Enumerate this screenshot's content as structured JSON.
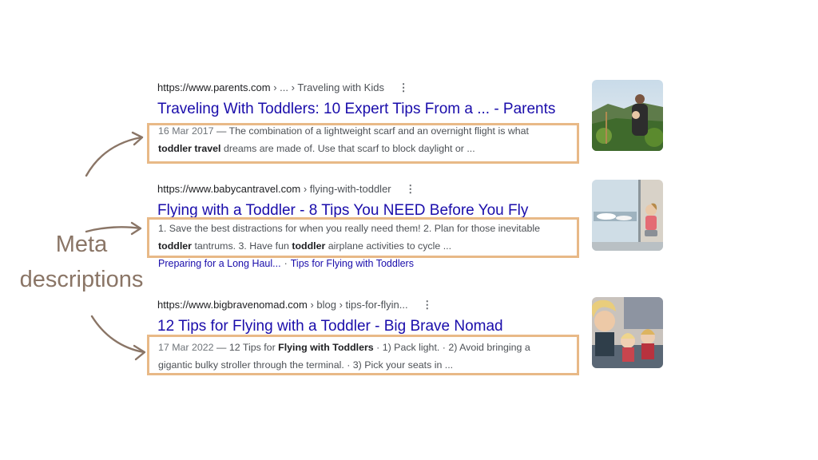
{
  "results": [
    {
      "url_host": "https://www.parents.com",
      "url_path": " › ... › Traveling with Kids",
      "title": "Traveling With Toddlers: 10 Expert Tips From a ... - Parents",
      "date": "16 Mar 2017",
      "snippet_line1": " — The combination of a lightweight scarf and an overnight flight is what",
      "snippet_bold": "toddler travel",
      "snippet_line2": " dreams are made of. Use that scarf to block daylight or ...",
      "thumbnail": "mountain-hiker-with-child"
    },
    {
      "url_host": "https://www.babycantravel.com",
      "url_path": " › flying-with-toddler",
      "title": "Flying with a Toddler - 8 Tips You NEED Before You Fly",
      "snippet_line1": "1. Save the best distractions for when you really need them! 2. Plan for those inevitable",
      "snippet_bold1": "toddler",
      "snippet_mid": " tantrums. 3. Have fun ",
      "snippet_bold2": "toddler",
      "snippet_end": " airplane activities to cycle ...",
      "sitelinks": [
        "Preparing for a Long Haul...",
        "Tips for Flying with Toddlers"
      ],
      "sitelink_separator": "·",
      "thumbnail": "toddler-at-airport-window"
    },
    {
      "url_host": "https://www.bigbravenomad.com",
      "url_path": " › blog › tips-for-flyin...",
      "title": "12 Tips for Flying with a Toddler - Big Brave Nomad",
      "date": "17 Mar 2022",
      "snippet_pre": " — 12 Tips for ",
      "snippet_bold": "Flying with Toddlers",
      "snippet_post": " · 1) Pack light. · 2) Avoid bringing a",
      "snippet_line2": "gigantic bulky stroller through the terminal. · 3) Pick your seats in ...",
      "thumbnail": "family-selfie-on-plane"
    }
  ],
  "kebab_glyph": "⋮",
  "annotation_line1": "Meta",
  "annotation_line2": "descriptions",
  "colors": {
    "highlight_box": "#e8b987",
    "annotation": "#8a7566",
    "link": "#1a0dab"
  }
}
